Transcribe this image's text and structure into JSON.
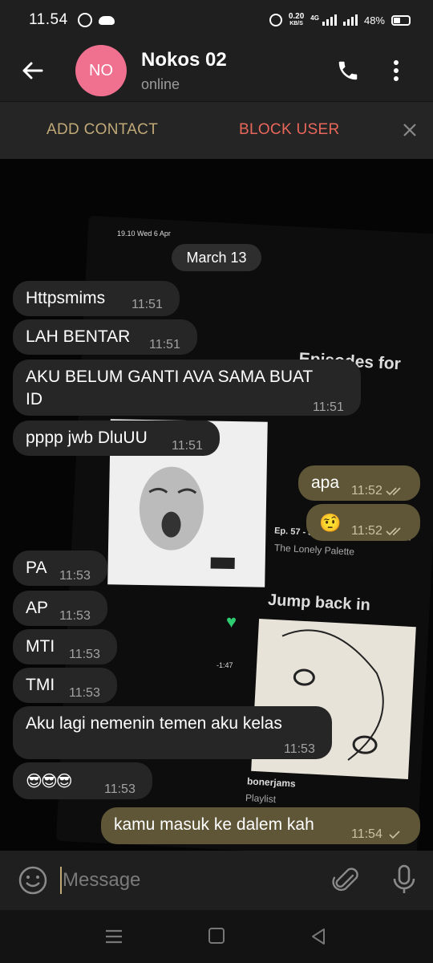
{
  "status_bar": {
    "time": "11.54",
    "net_speed": "0.20",
    "net_speed_unit": "KB/S",
    "network": "4G",
    "battery": "48%"
  },
  "header": {
    "avatar_initials": "NO",
    "contact_name": "Nokos 02",
    "status": "online",
    "avatar_color": "#f07090"
  },
  "action_strip": {
    "add_contact": "ADD CONTACT",
    "block_user": "BLOCK USER"
  },
  "chat": {
    "date_label": "March 13",
    "messages": [
      {
        "dir": "in",
        "text": "Httpsmims",
        "time": "11:51"
      },
      {
        "dir": "in",
        "text": "LAH BENTAR",
        "time": "11:51"
      },
      {
        "dir": "in",
        "text_line1": "AKU BELUM GANTI AVA SAMA BUAT",
        "text_line2": "ID",
        "time": "11:51"
      },
      {
        "dir": "in",
        "text": "pppp jwb DluUU",
        "time": "11:51"
      },
      {
        "dir": "out",
        "text": "apa",
        "time": "11:52",
        "status": "read"
      },
      {
        "dir": "out",
        "text": "🤨",
        "time": "11:52",
        "status": "read"
      },
      {
        "dir": "in",
        "text": "PA",
        "time": "11:53"
      },
      {
        "dir": "in",
        "text": "AP",
        "time": "11:53"
      },
      {
        "dir": "in",
        "text": "MTI",
        "time": "11:53"
      },
      {
        "dir": "in",
        "text": "TMI",
        "time": "11:53"
      },
      {
        "dir": "in",
        "text": "Aku lagi nemenin temen aku kelas",
        "time": "11:53"
      },
      {
        "dir": "in",
        "text": "😎😎😎",
        "time": "11:53"
      },
      {
        "dir": "out",
        "text": "kamu masuk ke dalem kah",
        "time": "11:54",
        "status": "sent"
      }
    ]
  },
  "wallpaper": {
    "top_text": "19.10  Wed 6 Apr",
    "heading_episodes": "Episodes for you",
    "episode_title": "Ep. 57 - Jelly, A Colossal Roma...",
    "episode_show": "The Lonely Palette",
    "heading_jump": "Jump back in",
    "playlist_name": "bonerjams",
    "playlist_type": "Playlist",
    "time_remaining": "-1:47"
  },
  "input": {
    "placeholder": "Message"
  },
  "colors": {
    "incoming_bubble": "#262626",
    "outgoing_bubble": "#5e5637",
    "accent": "#c0a977",
    "danger": "#e8675a"
  }
}
